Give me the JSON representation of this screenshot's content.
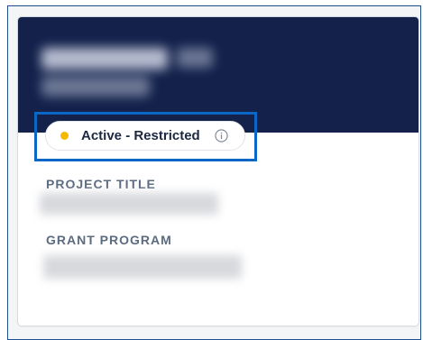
{
  "status": {
    "label": "Active - Restricted",
    "dot_color": "#f5b800",
    "info_icon": "info-circle-icon"
  },
  "fields": {
    "project_title_label": "PROJECT TITLE",
    "grant_program_label": "GRANT PROGRAM"
  },
  "colors": {
    "header_bg": "#13214b",
    "highlight_border": "#0a67c6",
    "label_color": "#5b6b80"
  }
}
